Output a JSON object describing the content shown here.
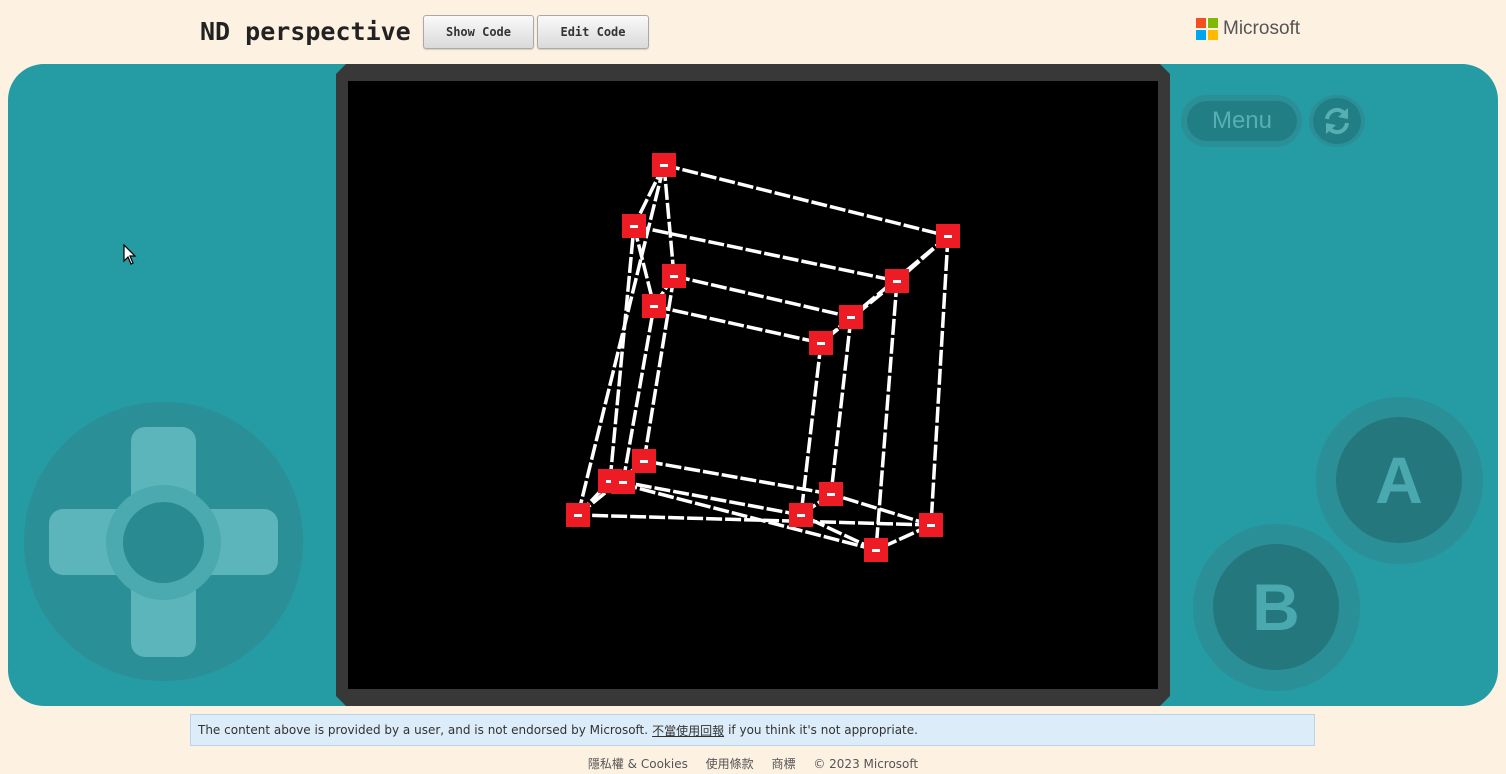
{
  "header": {
    "title": "ND perspective",
    "show_code_label": "Show Code",
    "edit_code_label": "Edit Code",
    "brand": "Microsoft",
    "brand_colors": [
      "#f25022",
      "#7fba00",
      "#00a4ef",
      "#ffb900"
    ]
  },
  "console": {
    "menu_label": "Menu",
    "reset_icon": "refresh-icon",
    "a_label": "A",
    "b_label": "B",
    "body_color": "#259ba3",
    "screen": {
      "background": "#000000",
      "edge_color": "#ffffff",
      "vertex_color": "#ed1c24"
    }
  },
  "notice": {
    "prefix": "The content above is provided by a user, and is not endorsed by Microsoft.",
    "link": "不當使用回報",
    "suffix": "if you think it's not appropriate."
  },
  "footer": {
    "privacy": "隱私權 & Cookies",
    "terms": "使用條款",
    "trademarks": "商標",
    "copyright": "© 2023 Microsoft"
  }
}
